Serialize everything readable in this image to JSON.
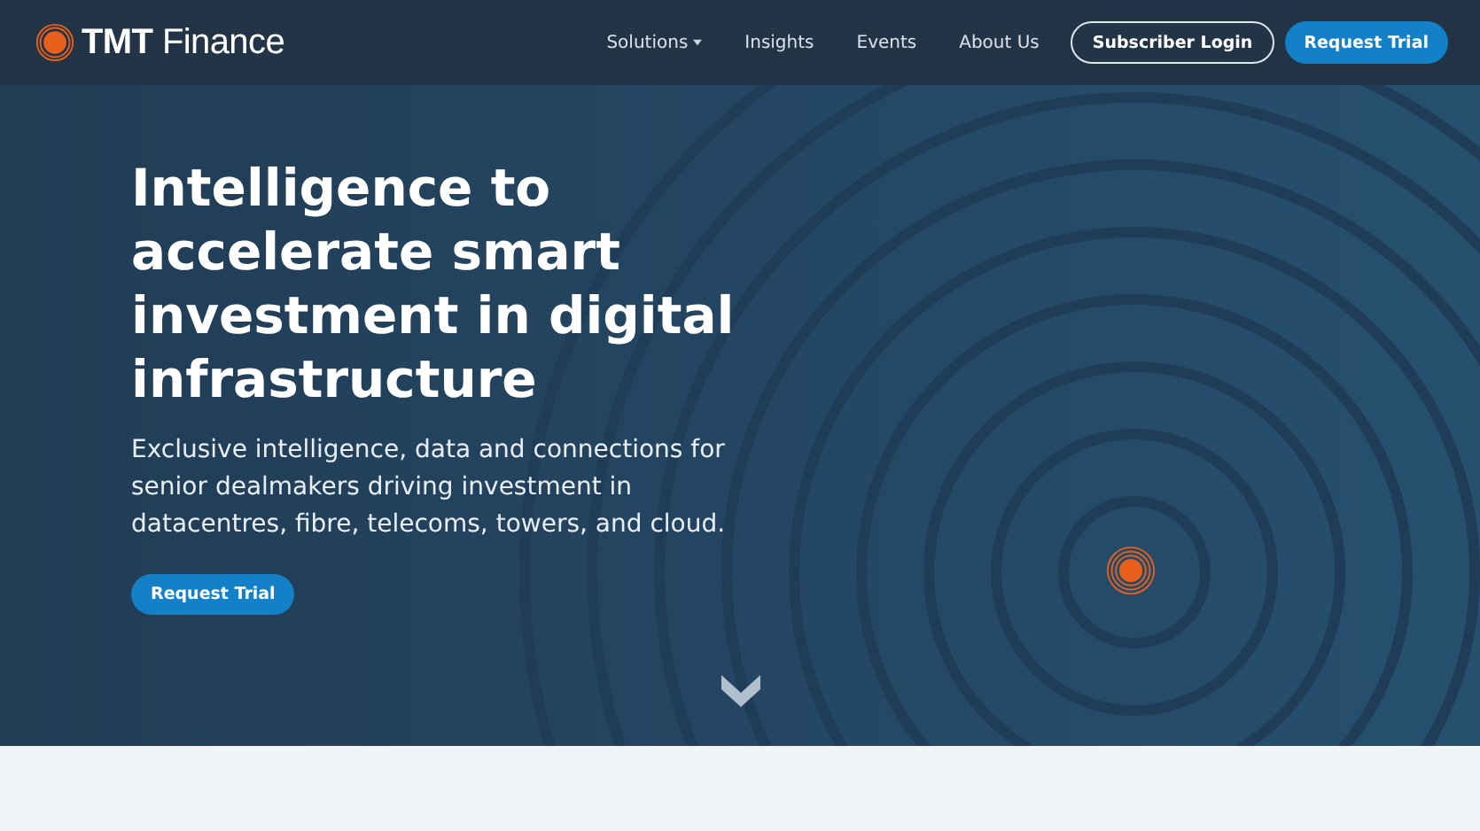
{
  "header": {
    "logo": {
      "text_bold": "TMT",
      "text": "Finance"
    },
    "nav": [
      {
        "label": "Solutions",
        "kind": "dropdown"
      },
      {
        "label": "Insights",
        "kind": "link"
      },
      {
        "label": "Events",
        "kind": "link"
      },
      {
        "label": "About Us",
        "kind": "link"
      }
    ],
    "buttons": [
      {
        "label": "Subscriber Login",
        "kind": "outline"
      },
      {
        "label": "Request Trial",
        "kind": "primary"
      }
    ]
  },
  "hero": {
    "heading": "Intelligence to accelerate smart investment in digital infrastructure",
    "subtitle": "Exclusive intelligence, data and connections for senior dealmakers driving investment in datacentres, fibre, telecoms, towers, and cloud.",
    "button": "Request Trial"
  }
}
